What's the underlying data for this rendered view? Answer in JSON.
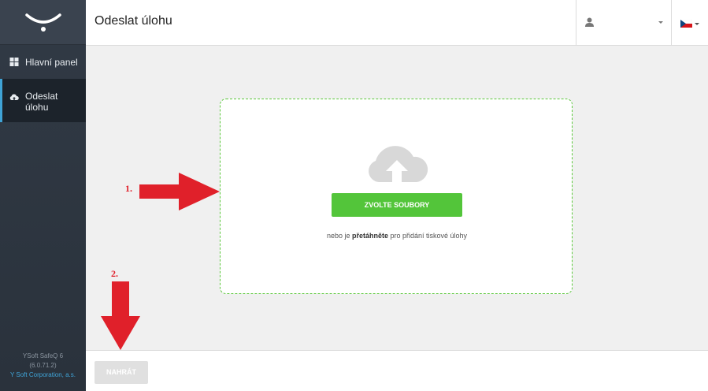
{
  "sidebar": {
    "logo_icon": "ysoft-logo-icon",
    "items": [
      {
        "label": "Hlavní panel",
        "icon": "dashboard-grid-icon"
      },
      {
        "label": "Odeslat\núlohu",
        "icon": "cloud-upload-icon",
        "active": true
      }
    ],
    "footer": {
      "product": "YSoft SafeQ 6",
      "version": "(6.0.71.2)",
      "company": "Y Soft Corporation, a.s."
    }
  },
  "header": {
    "title": "Odeslat úlohu",
    "user_icon": "user-icon",
    "language_flag": "czech-flag-icon"
  },
  "dropzone": {
    "icon": "cloud-upload-icon",
    "button_label": "ZVOLTE SOUBORY",
    "hint_prefix": "nebo je ",
    "hint_bold": "přetáhněte",
    "hint_suffix": " pro přidání tiskové úlohy"
  },
  "footer": {
    "upload_label": "NAHRÁT"
  },
  "annotations": {
    "step1": "1.",
    "step2": "2."
  },
  "colors": {
    "accent": "#3fa3d6",
    "primary_button": "#53c53a",
    "annotation": "#e0202a",
    "sidebar": "#2f3842"
  }
}
